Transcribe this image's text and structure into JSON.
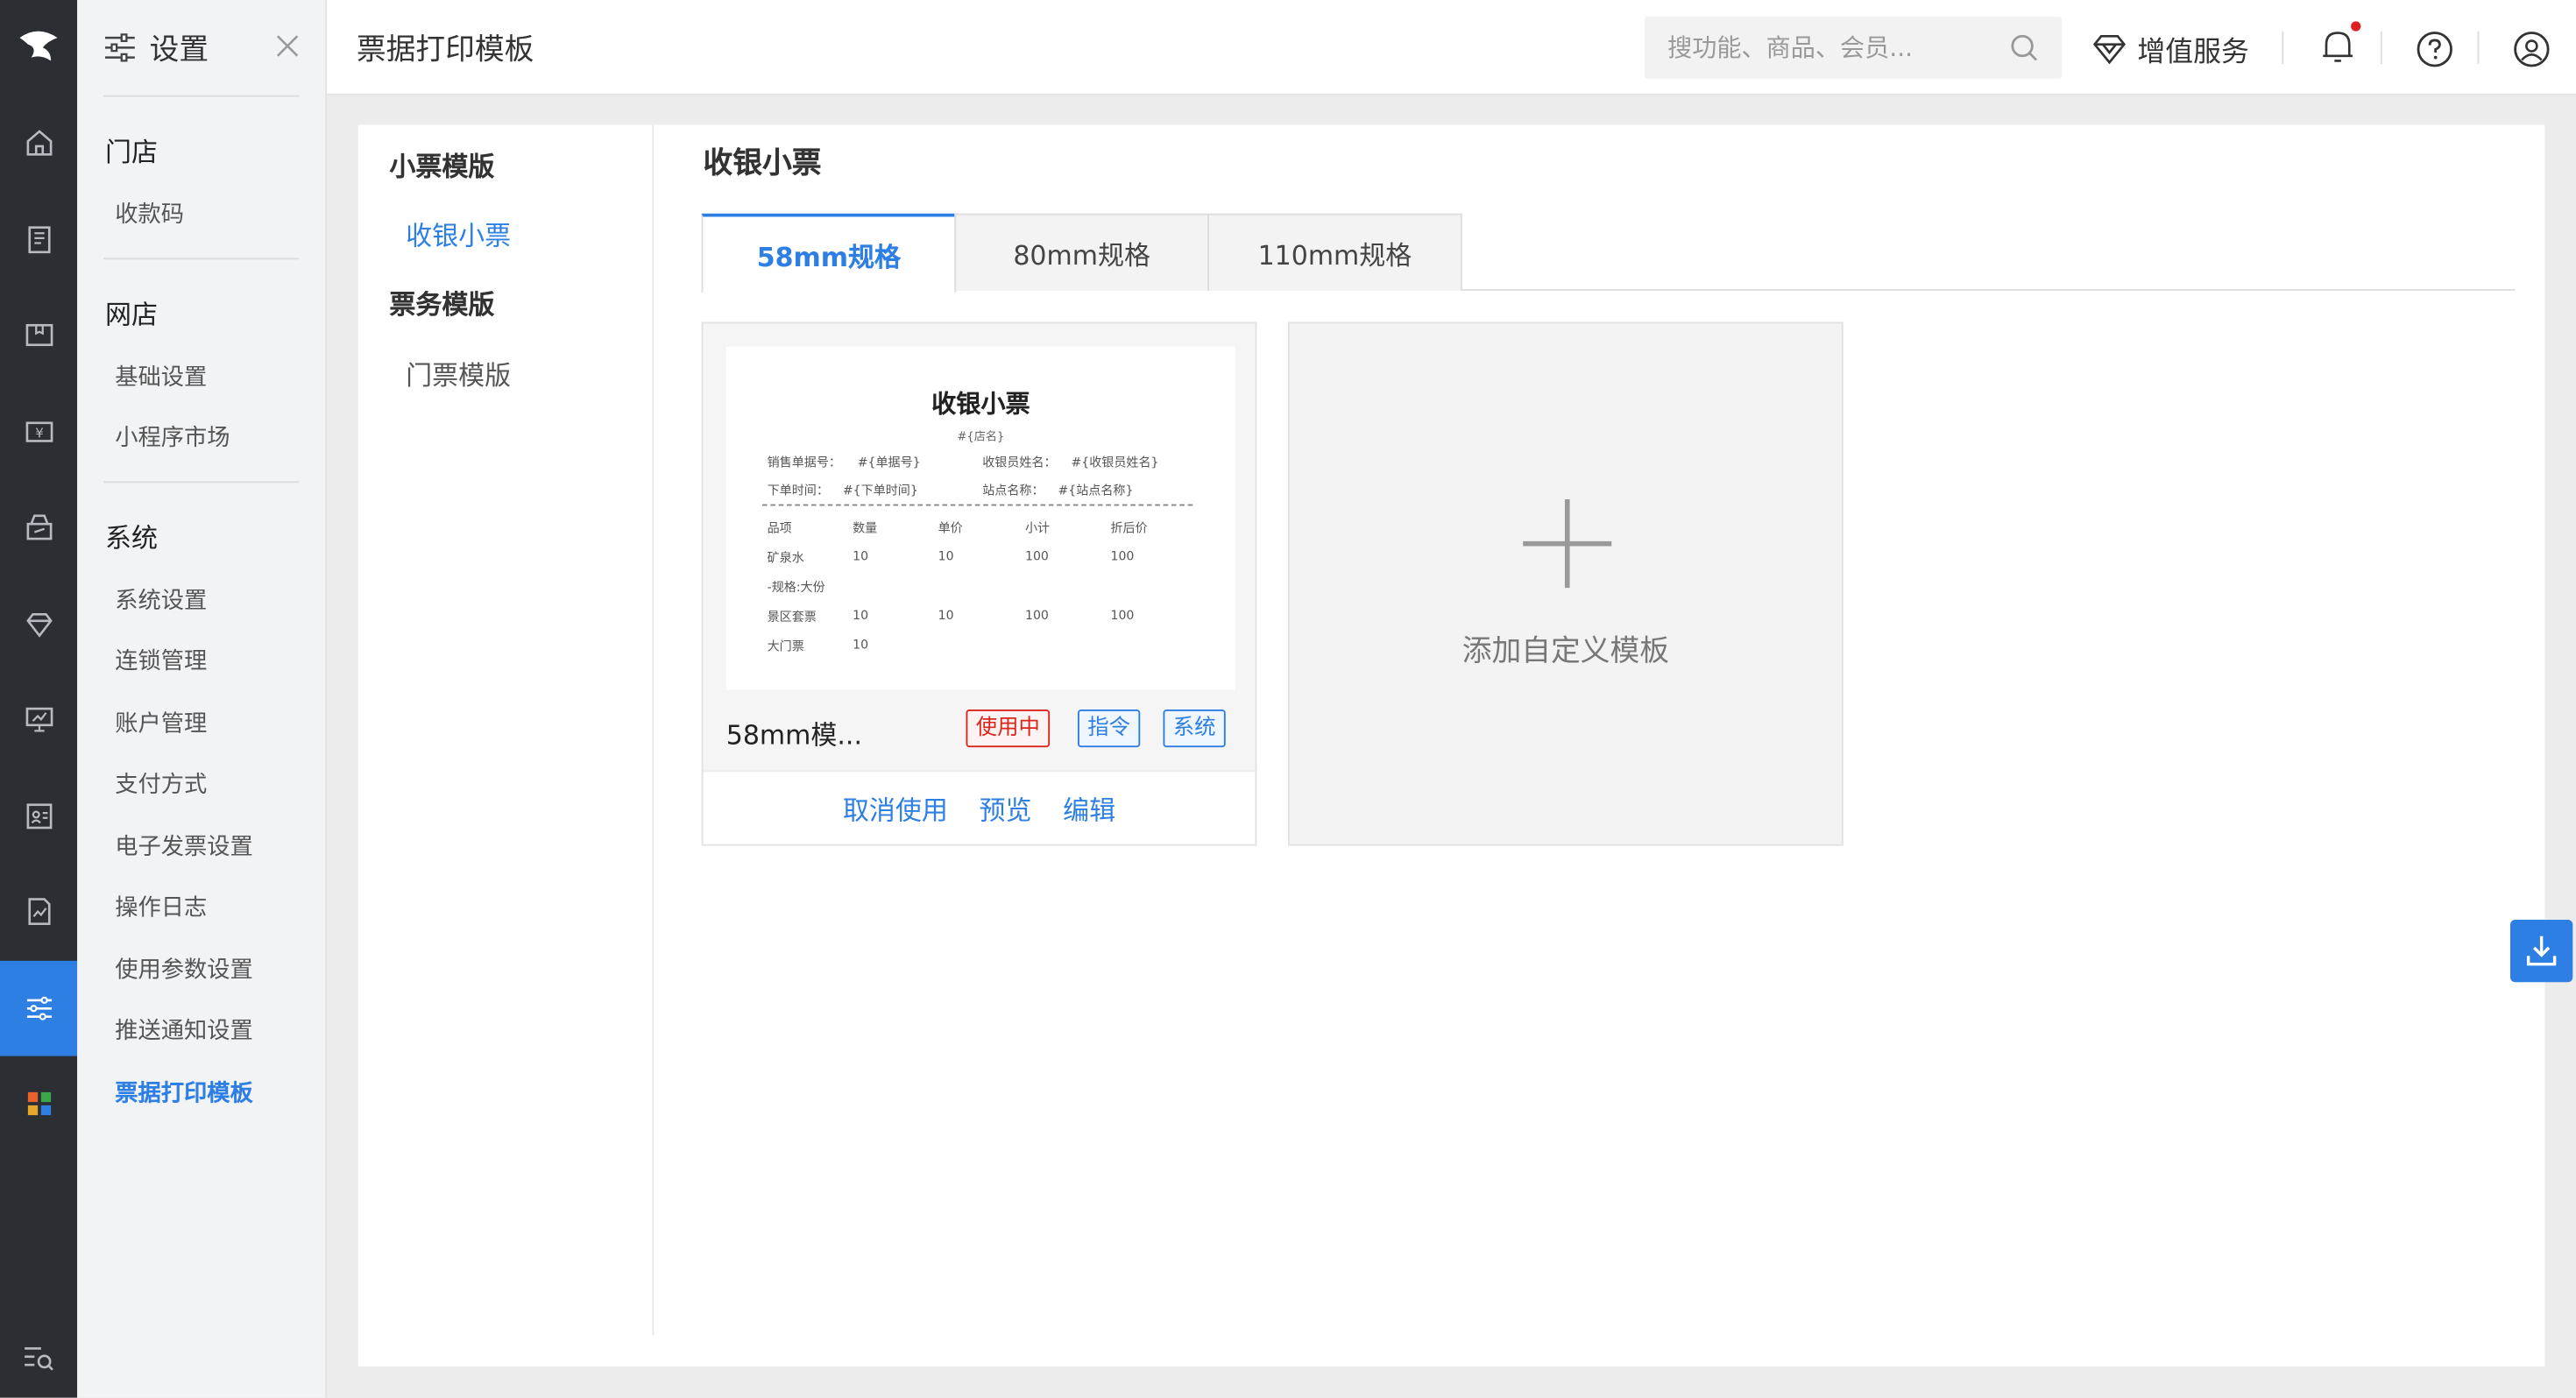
{
  "rail": {
    "items": [
      {
        "icon": "home-icon"
      },
      {
        "icon": "order-book-icon"
      },
      {
        "icon": "product-box-icon"
      },
      {
        "icon": "finance-icon"
      },
      {
        "icon": "marketing-icon"
      },
      {
        "icon": "vip-diamond-icon"
      },
      {
        "icon": "report-screen-icon"
      },
      {
        "icon": "member-card-icon"
      },
      {
        "icon": "analytics-icon"
      },
      {
        "icon": "settings-sliders-icon",
        "active": true
      },
      {
        "icon": "apps-grid-icon"
      }
    ]
  },
  "subnav": {
    "title": "设置",
    "groups": [
      {
        "label": "门店",
        "items": [
          "收款码"
        ]
      },
      {
        "label": "网店",
        "items": [
          "基础设置",
          "小程序市场"
        ]
      },
      {
        "label": "系统",
        "items": [
          "系统设置",
          "连锁管理",
          "账户管理",
          "支付方式",
          "电子发票设置",
          "操作日志",
          "使用参数设置",
          "推送通知设置",
          "票据打印模板"
        ]
      }
    ],
    "active_item": "票据打印模板"
  },
  "topbar": {
    "page_title": "票据打印模板",
    "search_placeholder": "搜功能、商品、会员...",
    "value_added": "增值服务"
  },
  "leftpane": {
    "groups": [
      {
        "label": "小票模版",
        "items": [
          "收银小票"
        ]
      },
      {
        "label": "票务模版",
        "items": [
          "门票模版"
        ]
      }
    ],
    "active_item": "收银小票"
  },
  "main": {
    "section_title": "收银小票",
    "tabs": [
      "58mm规格",
      "80mm规格",
      "110mm规格"
    ],
    "active_tab": "58mm规格",
    "template_card": {
      "preview": {
        "title": "收银小票",
        "store": "#{店名}",
        "lines": [
          [
            "销售单据号：",
            "#{单据号}",
            "收银员姓名：",
            "#{收银员姓名}"
          ],
          [
            "下单时间：",
            "#{下单时间}",
            "站点名称：",
            "#{站点名称}"
          ]
        ],
        "columns": [
          "品项",
          "数量",
          "单价",
          "小计",
          "折后价"
        ],
        "rows": [
          [
            "矿泉水",
            "10",
            "10",
            "100",
            "100"
          ],
          [
            "-规格:大份",
            "",
            "",
            "",
            ""
          ],
          [
            "景区套票",
            "10",
            "10",
            "100",
            "100"
          ],
          [
            "大门票",
            "10",
            "",
            "",
            ""
          ]
        ]
      },
      "name": "58mm模...",
      "badges": [
        "使用中",
        "指令",
        "系统"
      ],
      "actions": [
        "取消使用",
        "预览",
        "编辑"
      ]
    },
    "add_card": {
      "label": "添加自定义模板"
    }
  },
  "colors": {
    "accent": "#2d7fe3",
    "rail_bg": "#2b2e33",
    "in_use_red": "#d9261c"
  }
}
